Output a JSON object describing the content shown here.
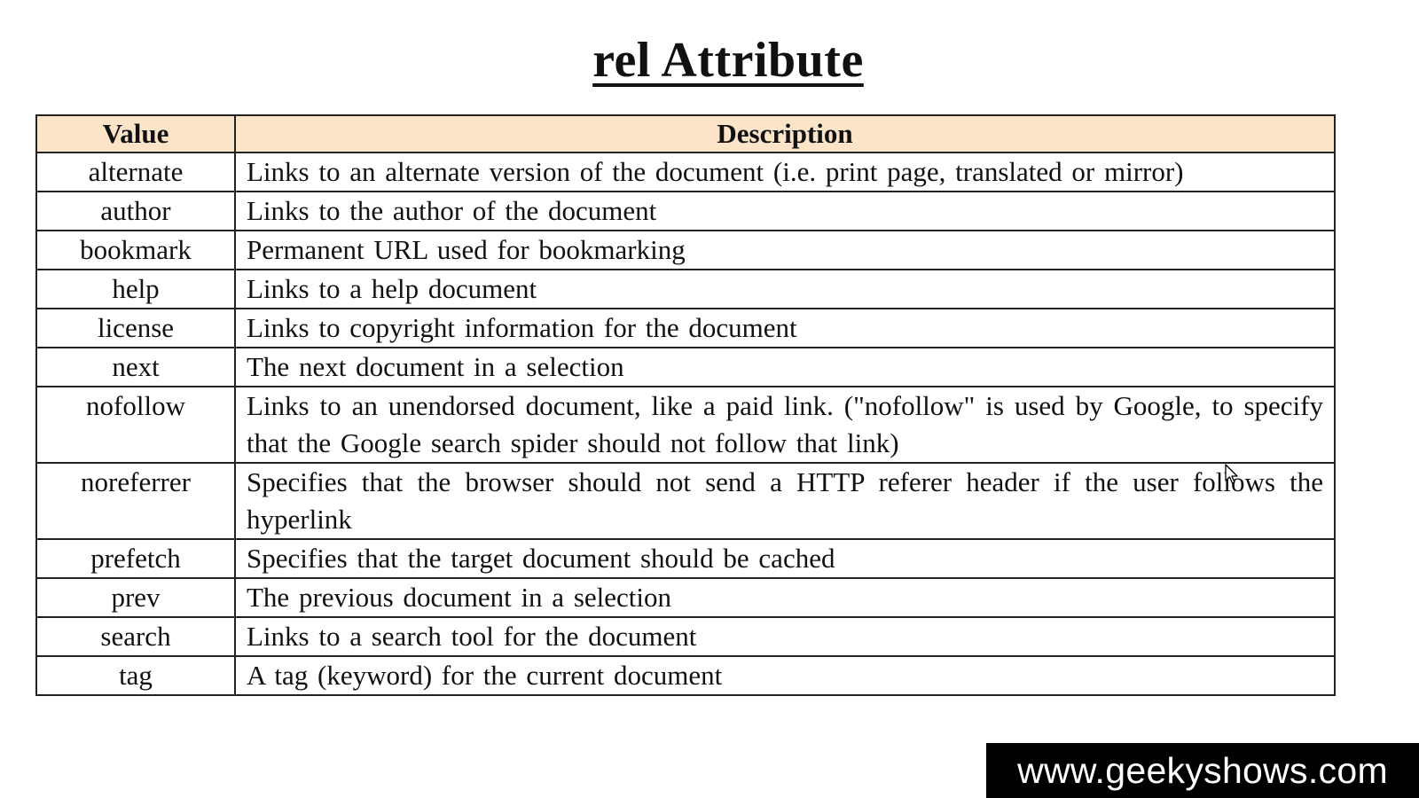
{
  "title": "rel Attribute",
  "table": {
    "headers": [
      "Value",
      "Description"
    ],
    "rows": [
      {
        "value": "alternate",
        "description": "Links to an alternate version of the document (i.e. print page, translated or mirror)"
      },
      {
        "value": "author",
        "description": "Links to the author of the document"
      },
      {
        "value": "bookmark",
        "description": "Permanent URL used for bookmarking"
      },
      {
        "value": "help",
        "description": "Links to a help document"
      },
      {
        "value": "license",
        "description": "Links to copyright information for the document"
      },
      {
        "value": "next",
        "description": "The next document in a selection"
      },
      {
        "value": "nofollow",
        "description": "Links to an unendorsed document, like a paid link. (\"nofollow\" is used by Google, to specify that the Google search spider should not follow that link)"
      },
      {
        "value": "noreferrer",
        "description": "Specifies that the browser should not send a HTTP referer header if the user follows the hyperlink"
      },
      {
        "value": "prefetch",
        "description": "Specifies that the target document should be cached"
      },
      {
        "value": "prev",
        "description": "The previous document in a selection"
      },
      {
        "value": "search",
        "description": "Links to a search tool for the document"
      },
      {
        "value": "tag",
        "description": "A tag (keyword) for the current document"
      }
    ]
  },
  "watermark": "www.geekyshows.com",
  "colors": {
    "header_bg": "#fce4c8",
    "border": "#222222",
    "watermark_bg": "#000000",
    "watermark_text": "#ffffff"
  },
  "icons": {
    "cursor": "mouse-pointer-icon"
  }
}
